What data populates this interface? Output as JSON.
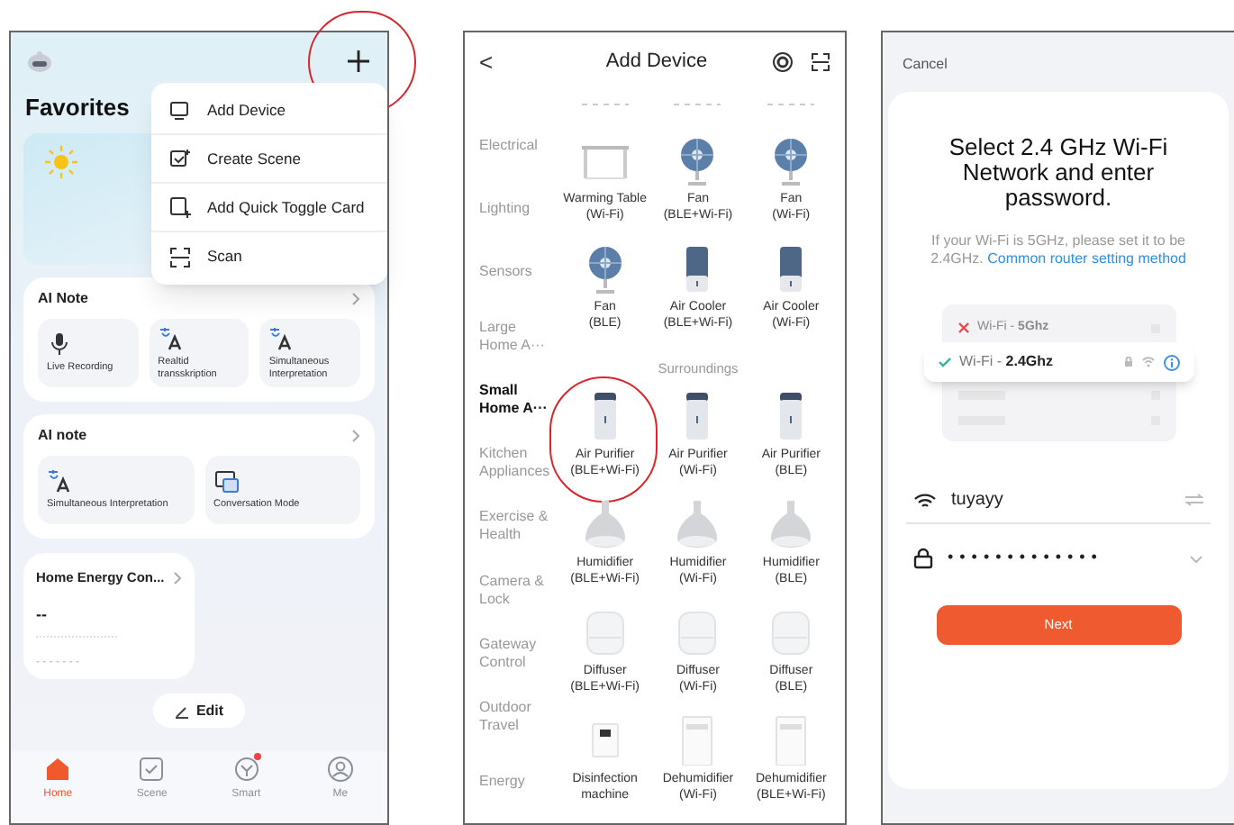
{
  "home_screen": {
    "add_button": {
      "highlighted": true
    },
    "title": "Favorites",
    "menu": [
      {
        "label": "Add Device"
      },
      {
        "label": "Create Scene"
      },
      {
        "label": "Add Quick Toggle Card"
      },
      {
        "label": "Scan"
      }
    ],
    "cards": [
      {
        "title": "AI Note",
        "tiles": [
          {
            "label": "Live Recording"
          },
          {
            "label": "Realtid transskription"
          },
          {
            "label": "Simultaneous Interpretation"
          }
        ]
      },
      {
        "title": "AI note",
        "tiles": [
          {
            "label": "Simultaneous Interpretation"
          },
          {
            "label": "Conversation Mode"
          }
        ]
      }
    ],
    "energy_card": {
      "title": "Home Energy Con...",
      "value": "--",
      "detail": "- - - - - - -"
    },
    "edit_button": "Edit",
    "nav": [
      {
        "label": "Home",
        "selected": true,
        "badge": false
      },
      {
        "label": "Scene",
        "selected": false,
        "badge": false
      },
      {
        "label": "Smart",
        "selected": false,
        "badge": true
      },
      {
        "label": "Me",
        "selected": false,
        "badge": false
      }
    ]
  },
  "add_device_screen": {
    "back": "<",
    "title": "Add Device",
    "categories": [
      {
        "label": "Electrical",
        "selected": false
      },
      {
        "label": "Lighting",
        "selected": false
      },
      {
        "label": "Sensors",
        "selected": false
      },
      {
        "label": "Large Home A···",
        "selected": false
      },
      {
        "label": "Small Home A···",
        "selected": true
      },
      {
        "label": "Kitchen Appliances",
        "selected": false
      },
      {
        "label": "Exercise & Health",
        "selected": false
      },
      {
        "label": "Camera & Lock",
        "selected": false
      },
      {
        "label": "Gateway Control",
        "selected": false
      },
      {
        "label": "Outdoor Travel",
        "selected": false
      },
      {
        "label": "Energy",
        "selected": false
      }
    ],
    "sections": [
      {
        "items": [
          {
            "kind": "table",
            "name": "Warming Table",
            "variant": "(Wi-Fi)",
            "highlighted": false
          },
          {
            "kind": "fan",
            "name": "Fan",
            "variant": "(BLE+Wi-Fi)",
            "highlighted": false
          },
          {
            "kind": "fan",
            "name": "Fan",
            "variant": "(Wi-Fi)",
            "highlighted": false
          },
          {
            "kind": "fan",
            "name": "Fan",
            "variant": "(BLE)",
            "highlighted": false
          },
          {
            "kind": "cooler",
            "name": "Air Cooler",
            "variant": "(BLE+Wi-Fi)",
            "highlighted": false
          },
          {
            "kind": "cooler",
            "name": "Air Cooler",
            "variant": "(Wi-Fi)",
            "highlighted": false
          }
        ]
      },
      {
        "title": "Surroundings",
        "items": [
          {
            "kind": "purifier",
            "name": "Air Purifier",
            "variant": "(BLE+Wi-Fi)",
            "highlighted": true
          },
          {
            "kind": "purifier",
            "name": "Air Purifier",
            "variant": "(Wi-Fi)",
            "highlighted": false
          },
          {
            "kind": "purifier",
            "name": "Air Purifier",
            "variant": "(BLE)",
            "highlighted": false
          },
          {
            "kind": "humidifier",
            "name": "Humidifier",
            "variant": "(BLE+Wi-Fi)",
            "highlighted": false
          },
          {
            "kind": "humidifier",
            "name": "Humidifier",
            "variant": "(Wi-Fi)",
            "highlighted": false
          },
          {
            "kind": "humidifier",
            "name": "Humidifier",
            "variant": "(BLE)",
            "highlighted": false
          },
          {
            "kind": "diffuser",
            "name": "Diffuser",
            "variant": "(BLE+Wi-Fi)",
            "highlighted": false
          },
          {
            "kind": "diffuser",
            "name": "Diffuser",
            "variant": "(Wi-Fi)",
            "highlighted": false
          },
          {
            "kind": "diffuser",
            "name": "Diffuser",
            "variant": "(BLE)",
            "highlighted": false
          },
          {
            "kind": "disinfector",
            "name": "Disinfection machine",
            "highlighted": false
          },
          {
            "kind": "dehumidifier",
            "name": "Dehumidifier",
            "variant": "(Wi-Fi)",
            "highlighted": false
          },
          {
            "kind": "dehumidifier",
            "name": "Dehumidifier",
            "variant": "(BLE+Wi-Fi)",
            "highlighted": false
          }
        ]
      }
    ]
  },
  "wifi_screen": {
    "cancel": "Cancel",
    "title": "Select 2.4 GHz Wi-Fi Network and enter password.",
    "hint": "If your Wi-Fi is 5GHz, please set it to be 2.4GHz.",
    "link": "Common router setting method",
    "networks": [
      {
        "label": "Wi-Fi - **5Ghz**",
        "selected": false
      },
      {
        "label": "Wi-Fi - **2.4Ghz**",
        "selected": true
      }
    ],
    "network_name": "tuyayy",
    "password": "•••••••••••••",
    "next_button": "Next"
  }
}
